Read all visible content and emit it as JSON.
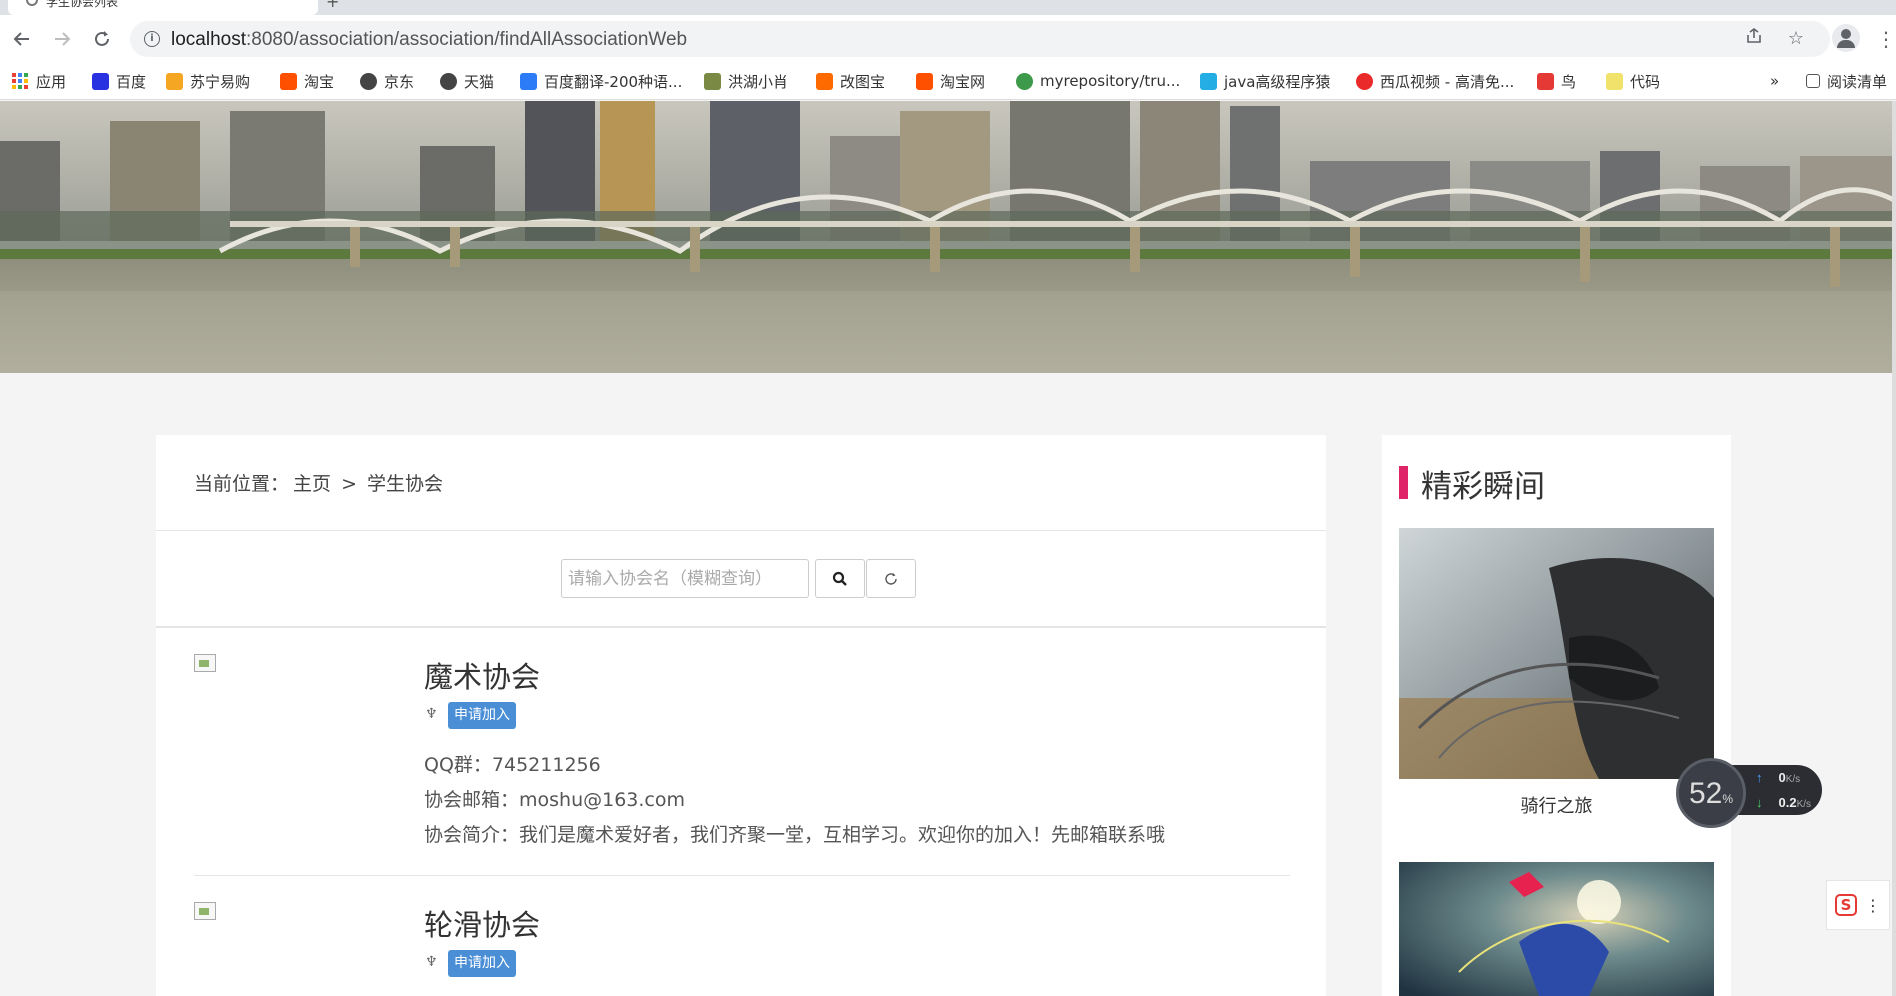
{
  "browser": {
    "tab_title": "学生协会列表",
    "new_tab": "+",
    "url_host": "localhost",
    "url_path": ":8080/association/association/findAllAssociationWeb",
    "bookmarks": [
      {
        "label": "应用",
        "icon": "apps-grid-icon"
      },
      {
        "label": "百度",
        "icon": "baidu-icon",
        "color": "#2932e1"
      },
      {
        "label": "苏宁易购",
        "icon": "suning-icon",
        "color": "#f5a623"
      },
      {
        "label": "淘宝",
        "icon": "taobao-icon",
        "color": "#ff5000"
      },
      {
        "label": "京东",
        "icon": "globe-icon",
        "color": "#444444"
      },
      {
        "label": "天猫",
        "icon": "globe-icon",
        "color": "#444444"
      },
      {
        "label": "百度翻译-200种语...",
        "icon": "baidu-translate-icon",
        "color": "#2b7cf6"
      },
      {
        "label": "洪湖小肖",
        "icon": "bird-icon",
        "color": "#7a8a45"
      },
      {
        "label": "改图宝",
        "icon": "gaitubao-icon",
        "color": "#ff6a00"
      },
      {
        "label": "淘宝网",
        "icon": "taobao-icon",
        "color": "#ff5000"
      },
      {
        "label": "myrepository/tru...",
        "icon": "chrome-icon",
        "color": "#3c9a4a"
      },
      {
        "label": "java高级程序猿",
        "icon": "bilibili-icon",
        "color": "#23ade5"
      },
      {
        "label": "西瓜视频 - 高清免...",
        "icon": "xigua-icon",
        "color": "#ea2a2a"
      },
      {
        "label": "鸟",
        "icon": "bird-red-icon",
        "color": "#e53935"
      },
      {
        "label": "代码",
        "icon": "moon-icon",
        "color": "#f0e26a"
      }
    ],
    "bookmarks_more": "»",
    "reading_list": "阅读清单"
  },
  "breadcrumb": {
    "prefix": "当前位置：",
    "home": "主页",
    "sep": ">",
    "current": "学生协会"
  },
  "search": {
    "placeholder": "请输入协会名（模糊查询）"
  },
  "associations": [
    {
      "name": "魔术协会",
      "join_label": "申请加入",
      "qq": "QQ群：745211256",
      "email": "协会邮箱：moshu@163.com",
      "intro": "协会简介：我们是魔术爱好者，我们齐聚一堂，互相学习。欢迎你的加入！先邮箱联系哦"
    },
    {
      "name": "轮滑协会",
      "join_label": "申请加入"
    }
  ],
  "sidebar": {
    "title": "精彩瞬间",
    "accent_color": "#e02468",
    "photos": [
      {
        "caption": "骑行之旅"
      },
      {
        "caption": ""
      }
    ]
  },
  "netmon": {
    "percent": "52",
    "percent_unit": "%",
    "up": "0",
    "down": "0.2",
    "unit": "K/s"
  },
  "widget": {
    "logo": "S"
  }
}
